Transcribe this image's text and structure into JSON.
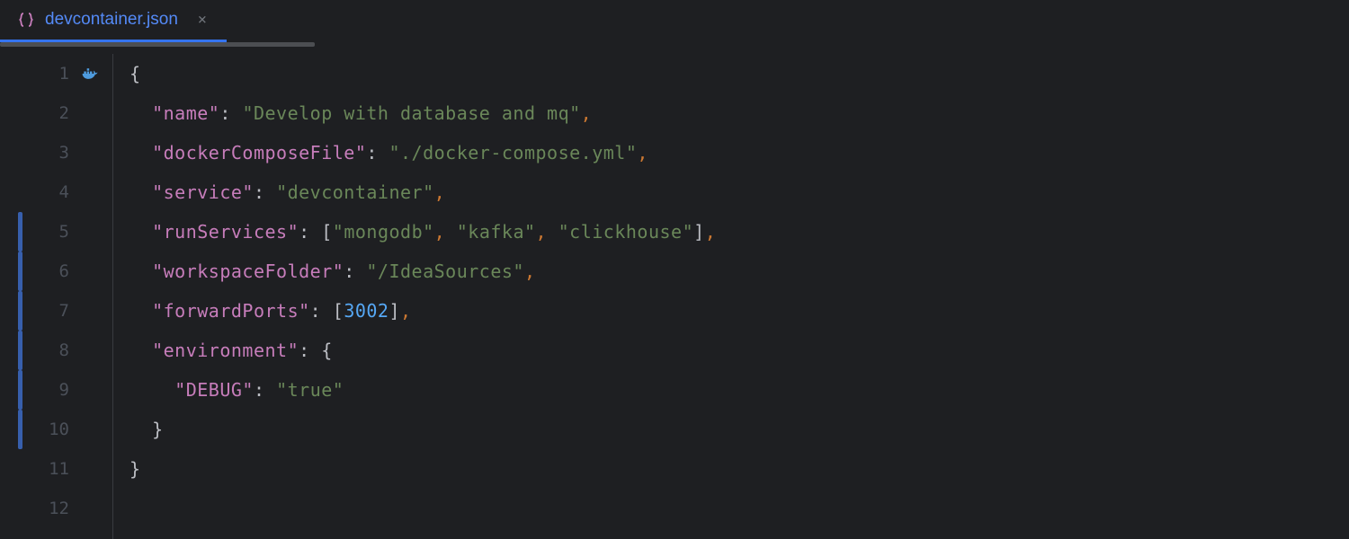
{
  "tab": {
    "filename": "devcontainer.json",
    "icon": "json-braces-icon",
    "close": "×"
  },
  "gutter": {
    "lines": [
      "1",
      "2",
      "3",
      "4",
      "5",
      "6",
      "7",
      "8",
      "9",
      "10",
      "11",
      "12"
    ],
    "docker_icon_line": 1,
    "modified_range": [
      5,
      10
    ]
  },
  "code": {
    "indent": "  ",
    "key_name": "\"name\"",
    "val_name": "\"Develop with database and mq\"",
    "key_dcf": "\"dockerComposeFile\"",
    "val_dcf": "\"./docker-compose.yml\"",
    "key_service": "\"service\"",
    "val_service": "\"devcontainer\"",
    "key_runsvc": "\"runServices\"",
    "val_mongo": "\"mongodb\"",
    "val_kafka": "\"kafka\"",
    "val_click": "\"clickhouse\"",
    "key_ws": "\"workspaceFolder\"",
    "val_ws": "\"/IdeaSources\"",
    "key_fp": "\"forwardPorts\"",
    "val_fp": "3002",
    "key_env": "\"environment\"",
    "key_debug": "\"DEBUG\"",
    "val_debug": "\"true\"",
    "brace_open": "{",
    "brace_close": "}",
    "bracket_open": "[",
    "bracket_close": "]",
    "colon": ": ",
    "comma": ",",
    "comma_sp": ", "
  }
}
